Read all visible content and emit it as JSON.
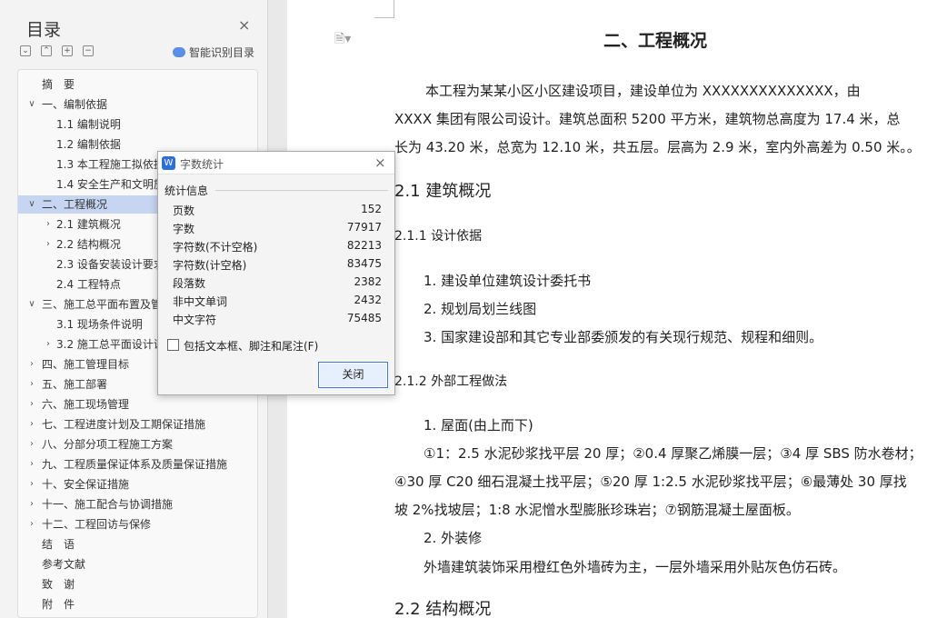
{
  "toc": {
    "title": "目录",
    "close": "×",
    "tools": [
      "⌄",
      "⌃",
      "+",
      "−"
    ],
    "smart_label": "智能识别目录",
    "items": [
      {
        "label": "摘　要",
        "level": 0,
        "arrow": ""
      },
      {
        "label": "一、编制依据",
        "level": 0,
        "arrow": "∨"
      },
      {
        "label": "1.1 编制说明",
        "level": 1,
        "arrow": ""
      },
      {
        "label": "1.2 编制依据",
        "level": 1,
        "arrow": ""
      },
      {
        "label": "1.3 本工程施工拟依据",
        "level": 1,
        "arrow": ""
      },
      {
        "label": "1.4 安全生产和文明施工",
        "level": 1,
        "arrow": ""
      },
      {
        "label": "二、工程概况",
        "level": 0,
        "arrow": "∨",
        "selected": true
      },
      {
        "label": "2.1 建筑概况",
        "level": 1,
        "arrow": "›"
      },
      {
        "label": "2.2 结构概况",
        "level": 1,
        "arrow": "›"
      },
      {
        "label": "2.3 设备安装设计要求",
        "level": 1,
        "arrow": ""
      },
      {
        "label": "2.4 工程特点",
        "level": 1,
        "arrow": ""
      },
      {
        "label": "三、施工总平面布置及管",
        "level": 0,
        "arrow": "∨"
      },
      {
        "label": "3.1 现场条件说明",
        "level": 1,
        "arrow": ""
      },
      {
        "label": "3.2 施工总平面设计说",
        "level": 1,
        "arrow": "›"
      },
      {
        "label": "四、施工管理目标",
        "level": 0,
        "arrow": "›"
      },
      {
        "label": "五、施工部署",
        "level": 0,
        "arrow": "›"
      },
      {
        "label": "六、施工现场管理",
        "level": 0,
        "arrow": "›"
      },
      {
        "label": "七、工程进度计划及工期保证措施",
        "level": 0,
        "arrow": "›"
      },
      {
        "label": "八、分部分项工程施工方案",
        "level": 0,
        "arrow": "›"
      },
      {
        "label": "九、工程质量保证体系及质量保证措施",
        "level": 0,
        "arrow": "›"
      },
      {
        "label": "十、安全保证措施",
        "level": 0,
        "arrow": "›"
      },
      {
        "label": "十一、施工配合与协调措施",
        "level": 0,
        "arrow": "›"
      },
      {
        "label": "十二、工程回访与保修",
        "level": 0,
        "arrow": "›"
      },
      {
        "label": "结　语",
        "level": 0,
        "arrow": ""
      },
      {
        "label": "参考文献",
        "level": 0,
        "arrow": ""
      },
      {
        "label": "致　谢",
        "level": 0,
        "arrow": ""
      },
      {
        "label": "附　件",
        "level": 0,
        "arrow": ""
      }
    ]
  },
  "doc": {
    "icon": "🗎▾",
    "lines": [
      {
        "cls": "h1",
        "text": "二、工程概况"
      },
      {
        "cls": "p",
        "text": "本工程为某某小区小区建设项目，建设单位为 XXXXXXXXXXXXXX，由"
      },
      {
        "cls": "p",
        "text": "XXXX 集团有限公司设计。建筑总面积 5200 平方米，建筑物总高度为 17.4 米，总"
      },
      {
        "cls": "p",
        "text": "长为 43.20 米，总宽为 12.10 米，共五层。层高为 2.9 米，室内外高差为 0.50 米。。"
      },
      {
        "cls": "h2",
        "text": "2.1  建筑概况"
      },
      {
        "cls": "h3",
        "text": "2.1.1 设计依据"
      },
      {
        "cls": "p",
        "text": "1. 建设单位建筑设计委托书"
      },
      {
        "cls": "p",
        "text": "2. 规划局划兰线图"
      },
      {
        "cls": "p",
        "text": "3. 国家建设部和其它专业部委颁发的有关现行规范、规程和细则。"
      },
      {
        "cls": "h3",
        "text": "2.1.2 外部工程做法"
      },
      {
        "cls": "p",
        "text": "1. 屋面(由上而下)"
      },
      {
        "cls": "p",
        "text": "①1：2.5 水泥砂浆找平层 20 厚；②0.4 厚聚乙烯膜一层；③4 厚 SBS 防水卷材；"
      },
      {
        "cls": "p",
        "text": "④30 厚 C20 细石混凝土找平层；⑤20 厚 1:2.5 水泥砂浆找平层；⑥最薄处 30 厚找"
      },
      {
        "cls": "p",
        "text": "坡 2%找坡层；1:8 水泥憎水型膨胀珍珠岩；⑦钢筋混凝土屋面板。"
      },
      {
        "cls": "p",
        "text": "2. 外装修"
      },
      {
        "cls": "p",
        "text": "外墙建筑装饰采用橙红色外墙砖为主，一层外墙采用外贴灰色仿石砖。"
      },
      {
        "cls": "h2",
        "text": "2.2  结构概况"
      }
    ]
  },
  "dialog": {
    "icon": "W",
    "title": "字数统计",
    "close": "×",
    "section": "统计信息",
    "stats": [
      {
        "label": "页数",
        "value": "152"
      },
      {
        "label": "字数",
        "value": "77917"
      },
      {
        "label": "字符数(不计空格)",
        "value": "82213"
      },
      {
        "label": "字符数(计空格)",
        "value": "83475"
      },
      {
        "label": "段落数",
        "value": "2382"
      },
      {
        "label": "非中文单词",
        "value": "2432"
      },
      {
        "label": "中文字符",
        "value": "75485"
      }
    ],
    "checkbox_label": "包括文本框、脚注和尾注(F)",
    "checkbox_checked": false,
    "close_button": "关闭"
  }
}
